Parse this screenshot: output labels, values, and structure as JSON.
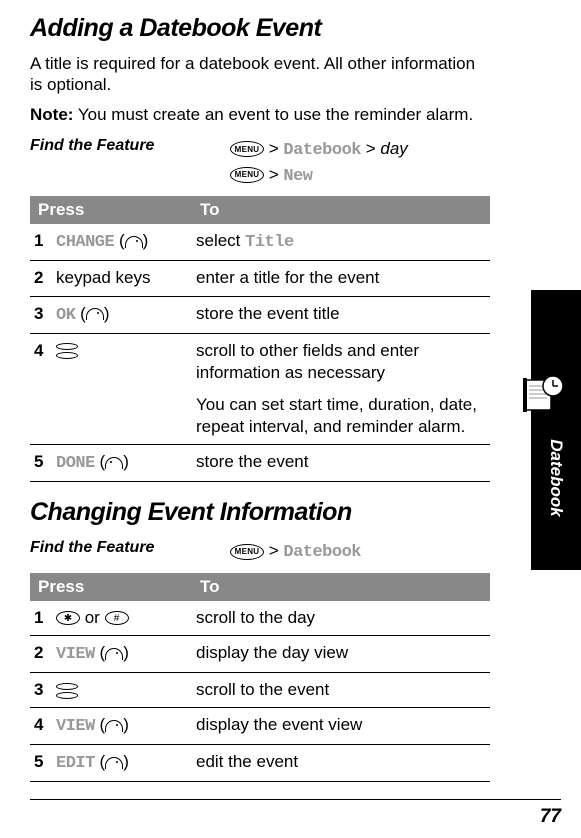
{
  "page_number": "77",
  "side_tab": "Datebook",
  "section1": {
    "title": "Adding a Datebook Event",
    "intro": "A title is required for a datebook event. All other information is optional.",
    "note_label": "Note:",
    "note_text": " You must create an event to use the reminder alarm.",
    "find_label": "Find the Feature",
    "path_menu": "MENU",
    "path_sep": " > ",
    "path_datebook": "Datebook",
    "path_day": "day",
    "path_new": "New",
    "table": {
      "head_press": "Press",
      "head_to": "To",
      "rows": [
        {
          "n": "1",
          "press": "CHANGE",
          "to_a": "select ",
          "to_code": "Title"
        },
        {
          "n": "2",
          "press_plain": "keypad keys",
          "to": "enter a title for the event"
        },
        {
          "n": "3",
          "press": "OK",
          "to": "store the event title"
        },
        {
          "n": "4",
          "scroll": true,
          "to": "scroll to other fields and enter information as necessary",
          "to2": "You can set start time, duration, date, repeat interval, and reminder alarm."
        },
        {
          "n": "5",
          "press": "DONE",
          "to": "store the event"
        }
      ]
    }
  },
  "section2": {
    "title": "Changing Event Information",
    "find_label": "Find the Feature",
    "path_menu": "MENU",
    "path_sep": " > ",
    "path_datebook": "Datebook",
    "table": {
      "head_press": "Press",
      "head_to": "To",
      "rows": [
        {
          "n": "1",
          "keys": [
            "*",
            "#"
          ],
          "or": " or ",
          "to": "scroll to the day"
        },
        {
          "n": "2",
          "press": "VIEW",
          "to": "display the day view"
        },
        {
          "n": "3",
          "scroll": true,
          "to": "scroll to the event"
        },
        {
          "n": "4",
          "press": "VIEW",
          "to": "display the event view"
        },
        {
          "n": "5",
          "press": "EDIT",
          "to": "edit the event"
        }
      ]
    }
  }
}
